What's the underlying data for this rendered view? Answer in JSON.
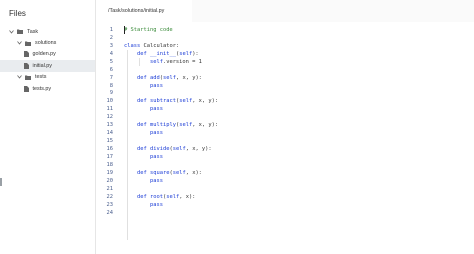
{
  "sidebar": {
    "title": "Files",
    "items": [
      {
        "label": "Task",
        "type": "folder",
        "level": 0,
        "expanded": true
      },
      {
        "label": "solutions",
        "type": "folder",
        "level": 1,
        "expanded": true
      },
      {
        "label": "golden.py",
        "type": "file",
        "level": 2
      },
      {
        "label": "initial.py",
        "type": "file",
        "level": 2,
        "selected": true
      },
      {
        "label": "tests",
        "type": "folder",
        "level": 1,
        "expanded": true
      },
      {
        "label": "tests.py",
        "type": "file",
        "level": 2
      }
    ]
  },
  "editor": {
    "tab_label": "/Task/solutions/initial.py",
    "lines": [
      {
        "n": "1",
        "text": "# Starting code"
      },
      {
        "n": "2",
        "text": ""
      },
      {
        "n": "3",
        "text": "class Calculator:"
      },
      {
        "n": "4",
        "text": "    def __init__(self):"
      },
      {
        "n": "5",
        "text": "        self.version = 1"
      },
      {
        "n": "6",
        "text": ""
      },
      {
        "n": "7",
        "text": "    def add(self, x, y):"
      },
      {
        "n": "8",
        "text": "        pass"
      },
      {
        "n": "9",
        "text": ""
      },
      {
        "n": "10",
        "text": "    def subtract(self, x, y):"
      },
      {
        "n": "11",
        "text": "        pass"
      },
      {
        "n": "12",
        "text": ""
      },
      {
        "n": "13",
        "text": "    def multiply(self, x, y):"
      },
      {
        "n": "14",
        "text": "        pass"
      },
      {
        "n": "15",
        "text": ""
      },
      {
        "n": "16",
        "text": "    def divide(self, x, y):"
      },
      {
        "n": "17",
        "text": "        pass"
      },
      {
        "n": "18",
        "text": ""
      },
      {
        "n": "19",
        "text": "    def square(self, x):"
      },
      {
        "n": "20",
        "text": "        pass"
      },
      {
        "n": "21",
        "text": ""
      },
      {
        "n": "22",
        "text": "    def root(self, x):"
      },
      {
        "n": "23",
        "text": "        pass"
      },
      {
        "n": "24",
        "text": ""
      }
    ]
  },
  "colors": {
    "keyword": "#1a3bd6",
    "comment": "#3a8b3a",
    "line_number": "#4b5f8e",
    "selected_bg": "#e9ecef"
  }
}
